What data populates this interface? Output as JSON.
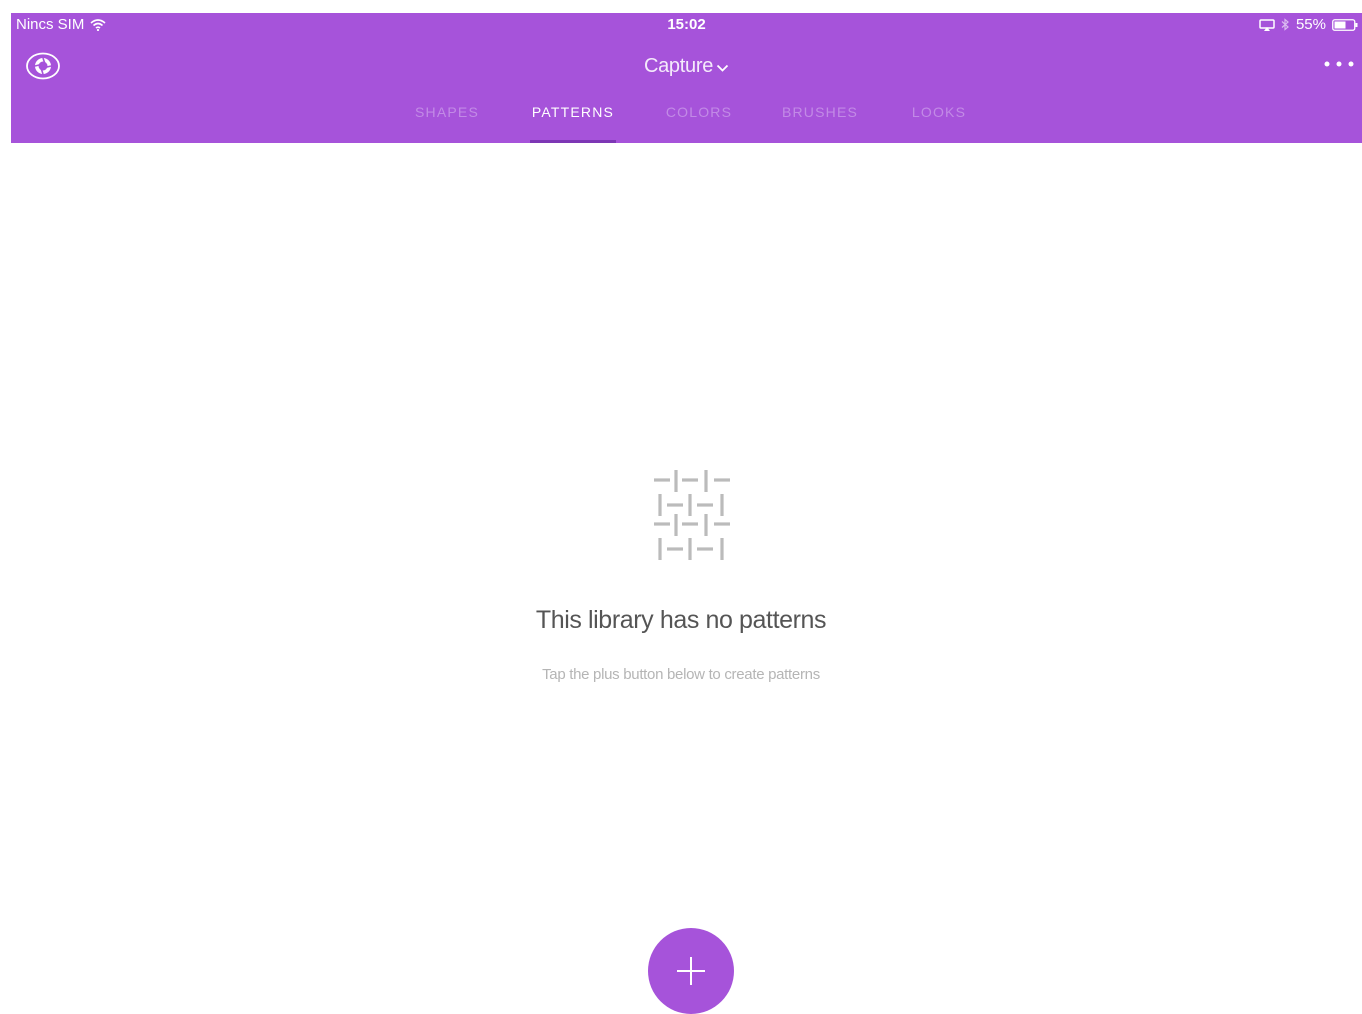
{
  "status_bar": {
    "carrier": "Nincs SIM",
    "time": "15:02",
    "battery": "55%"
  },
  "toolbar": {
    "library_title": "Capture"
  },
  "tabs": [
    {
      "label": "SHAPES",
      "active": false
    },
    {
      "label": "PATTERNS",
      "active": true
    },
    {
      "label": "COLORS",
      "active": false
    },
    {
      "label": "BRUSHES",
      "active": false
    },
    {
      "label": "LOOKS",
      "active": false
    }
  ],
  "empty_state": {
    "title": "This library has no patterns",
    "subtitle": "Tap the plus button below to create patterns"
  },
  "icons": {
    "logo": "capture-logo-icon",
    "more": "more-icon",
    "chevron": "chevron-down-icon",
    "pattern": "pattern-icon",
    "add": "plus-icon",
    "wifi": "wifi-icon",
    "airplay": "airplay-icon",
    "bluetooth": "bluetooth-icon",
    "battery": "battery-icon"
  },
  "colors": {
    "header_bg": "#a653da",
    "tab_indicator": "#7d37b5",
    "add_button": "#a653da",
    "empty_title": "#555555",
    "empty_subtitle": "#b5b5b5",
    "pattern_icon": "#bbbbbb"
  }
}
